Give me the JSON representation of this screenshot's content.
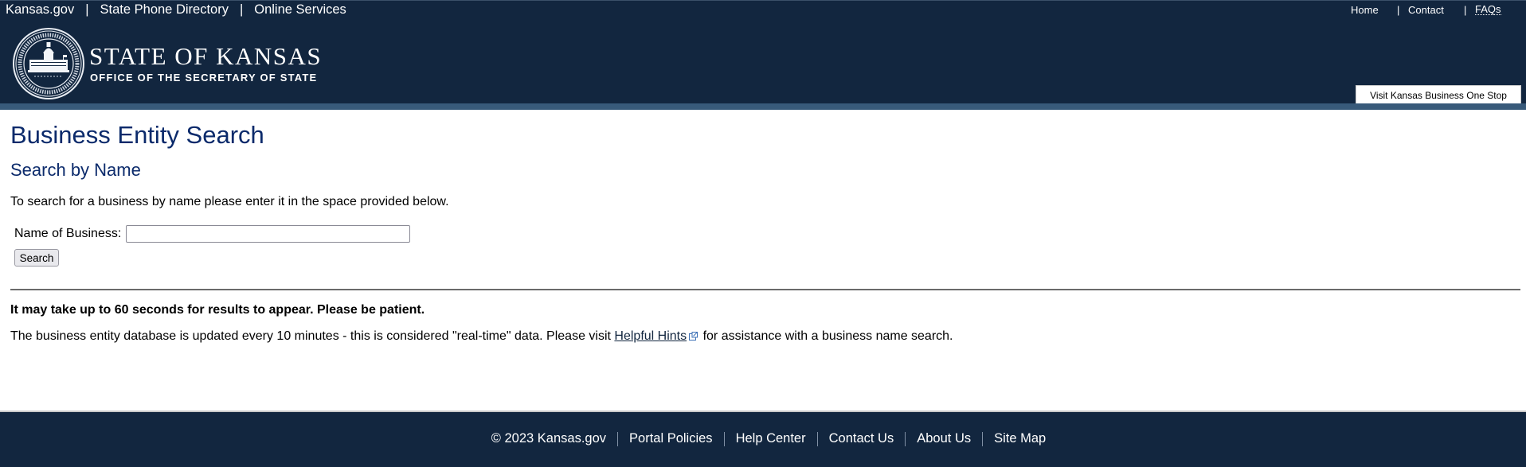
{
  "header": {
    "top_nav_left": [
      "Kansas.gov",
      "State Phone Directory",
      "Online Services"
    ],
    "top_nav_separator": "|",
    "top_nav_right": [
      "Home",
      "Contact",
      "FAQs"
    ],
    "brand_title": "STATE OF KANSAS",
    "brand_subtitle": "OFFICE OF THE SECRETARY OF STATE",
    "seal_icon": "secretary-of-state-seal-icon",
    "one_stop_button": "Visit Kansas Business One Stop"
  },
  "main": {
    "page_title": "Business Entity Search",
    "section_title": "Search by Name",
    "intro": "To search for a business by name please enter it in the space provided below.",
    "name_label": "Name of Business:",
    "name_value": "",
    "search_button": "Search",
    "notice": "It may take up to 60 seconds for results to appear. Please be patient.",
    "info_before": "The business entity database is updated every 10 minutes - this is considered \"real-time\" data. Please visit ",
    "info_link": "Helpful Hints",
    "info_after": " for assistance with a business name search.",
    "external_link_icon": "external-link-icon"
  },
  "footer": {
    "copyright": "© 2023 Kansas.gov",
    "links": [
      "Portal Policies",
      "Help Center",
      "Contact Us",
      "About Us",
      "Site Map"
    ]
  },
  "colors": {
    "header_bg": "#12263f",
    "header_band": "#385a7a",
    "heading_blue": "#0b2a6b",
    "footer_bg": "#12263f"
  }
}
